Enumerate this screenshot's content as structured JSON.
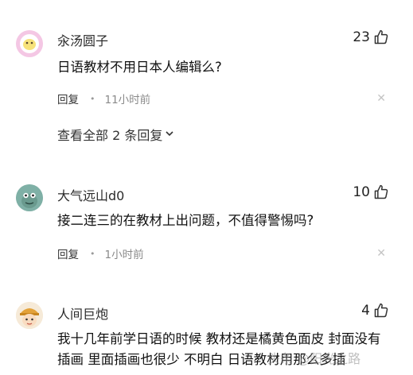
{
  "comments": [
    {
      "username": "汆汤圆子",
      "likes": "23",
      "text": "日语教材不用日本人编辑么?",
      "reply_label": "回复",
      "time": "11小时前",
      "view_replies": "查看全部 2 条回复"
    },
    {
      "username": "大气远山d0",
      "likes": "10",
      "text": "接二连三的在教材上出问题，不值得警惕吗?",
      "reply_label": "回复",
      "time": "1小时前"
    },
    {
      "username": "人间巨炮",
      "likes": "4",
      "text": "我十几年前学日语的时候 教材还是橘黄色面皮 封面没有插画 里面插画也很少 不明白 日语教材用那么多插"
    }
  ],
  "watermark": "头条 @阳光之路",
  "icons": {
    "like": "thumbs-up-icon",
    "dismiss": "close-icon",
    "expand": "chevron-down-icon"
  },
  "colors": {
    "text": "#111111",
    "meta": "#8a8a8a",
    "background": "#ffffff"
  }
}
